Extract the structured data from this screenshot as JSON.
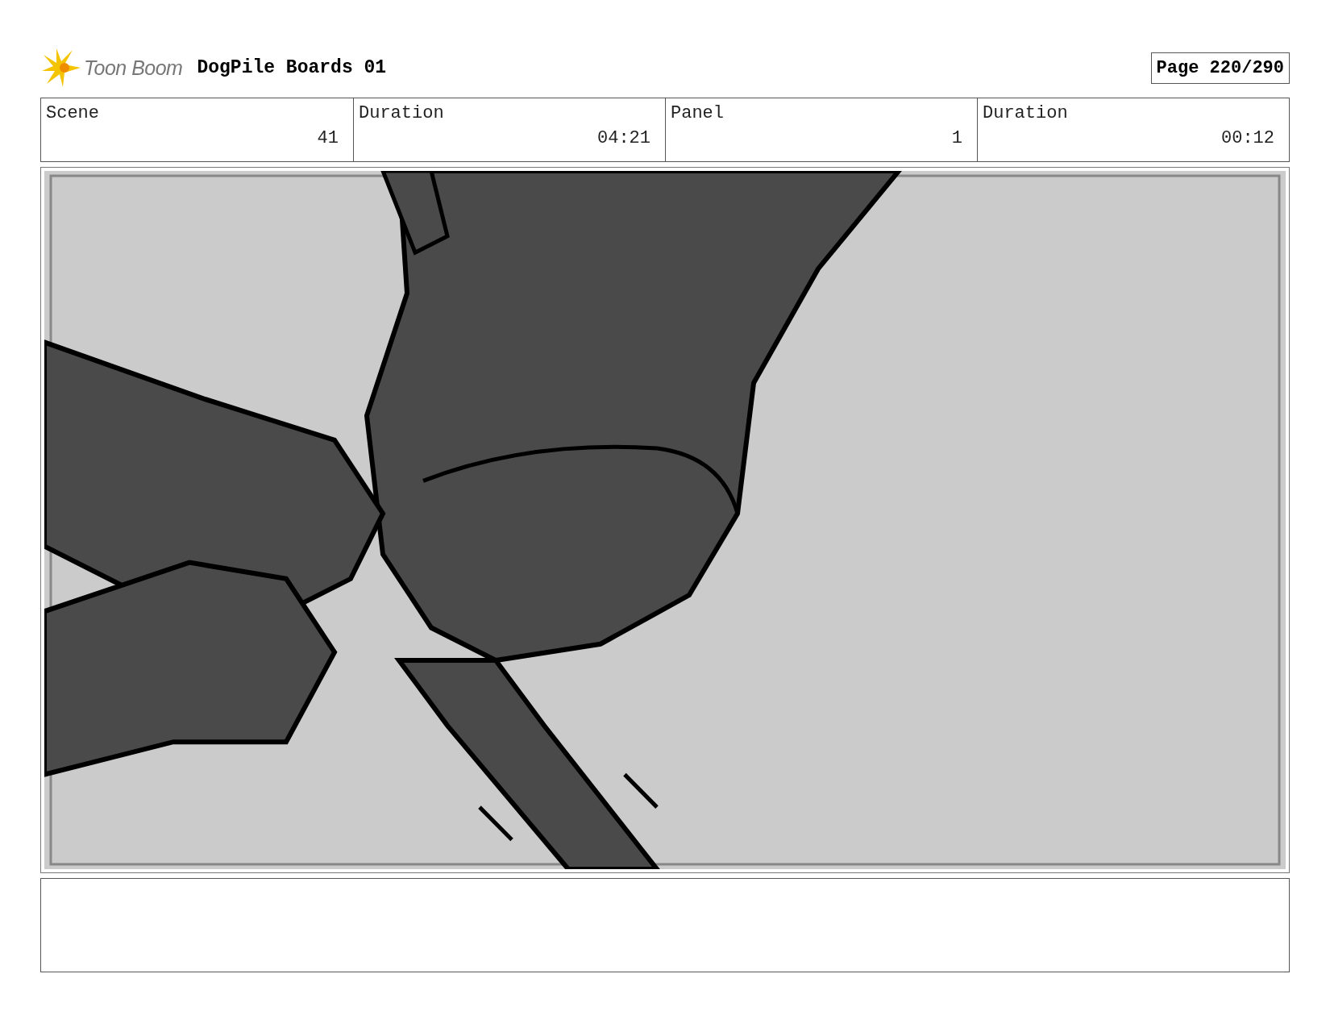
{
  "header": {
    "logo": "Toon Boom",
    "title": "DogPile Boards 01",
    "page": "Page 220/290"
  },
  "fields": [
    {
      "label": "Scene",
      "value": "41"
    },
    {
      "label": "Duration",
      "value": "04:21"
    },
    {
      "label": "Panel",
      "value": "1"
    },
    {
      "label": "Duration",
      "value": "00:12"
    }
  ]
}
